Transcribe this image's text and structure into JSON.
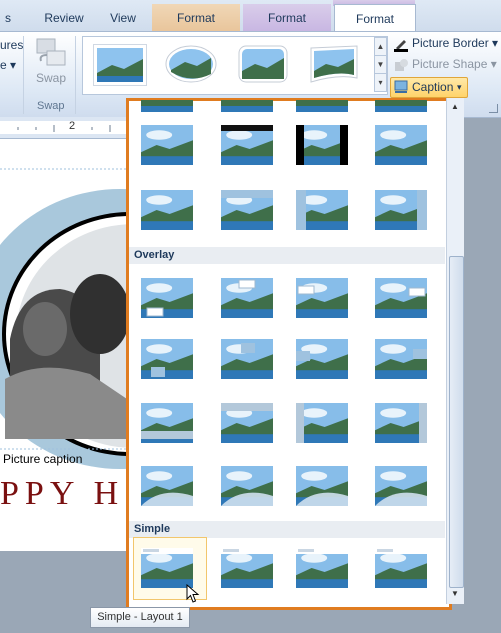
{
  "tabs": {
    "t1": "Review",
    "t2": "View",
    "t3": "Format",
    "t4": "Format",
    "t5": "Format",
    "left_partial": "s"
  },
  "ribbon": {
    "left_partial_top": "ures",
    "left_partial_mid": "e ▾",
    "swap_label": "Swap",
    "swap_group_label": "Swap",
    "picture_border": "Picture Border",
    "picture_shape": "Picture Shape",
    "caption": "Caption"
  },
  "ruler": {
    "mark": "2"
  },
  "document": {
    "caption_text": "Picture caption",
    "banner_text": "PPY H"
  },
  "dropdown": {
    "section_overlay": "Overlay",
    "section_simple": "Simple"
  },
  "tooltip": "Simple - Layout 1",
  "colors": {
    "accent": "#e07c20",
    "sky": "#6fa8dc",
    "mountain": "#3f6f4a",
    "water": "#2f78b7"
  }
}
